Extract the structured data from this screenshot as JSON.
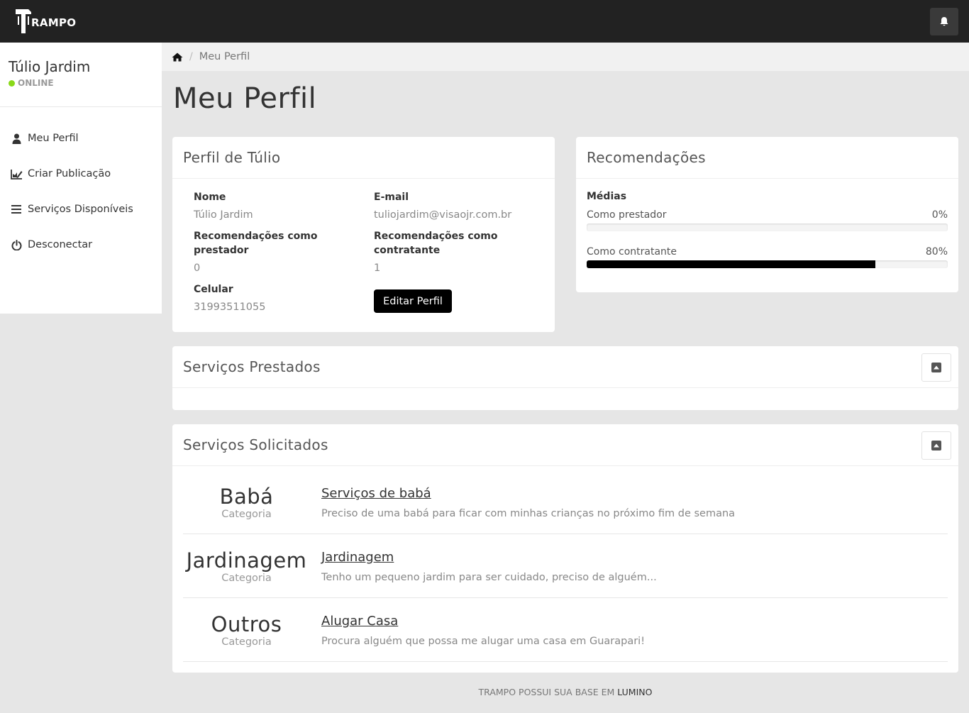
{
  "navbar": {
    "logo_text": "RAMPO",
    "notifications_icon": "bell-icon"
  },
  "sidebar": {
    "user_name": "Túlio Jardim",
    "status": "ONLINE",
    "status_color": "#8ad919",
    "items": [
      {
        "label": "Meu Perfil",
        "icon": "user-icon"
      },
      {
        "label": "Criar Publicação",
        "icon": "edit-chart-icon"
      },
      {
        "label": "Serviços Disponíveis",
        "icon": "list-icon"
      },
      {
        "label": "Desconectar",
        "icon": "power-icon"
      }
    ]
  },
  "breadcrumb": {
    "home_icon": "home-icon",
    "current": "Meu Perfil"
  },
  "page_title": "Meu Perfil",
  "profile": {
    "heading": "Perfil de Túlio",
    "name_label": "Nome",
    "name_value": "Túlio Jardim",
    "email_label": "E-mail",
    "email_value": "tuliojardim@visaojr.com.br",
    "rec_provider_label_1": "Recomendações como",
    "rec_provider_label_2": "prestador",
    "rec_provider_value": "0",
    "rec_client_label_1": "Recomendações como",
    "rec_client_label_2": "contratante",
    "rec_client_value": "1",
    "phone_label": "Celular",
    "phone_value": "31993511055",
    "edit_button": "Editar Perfil"
  },
  "recommendations": {
    "heading": "Recomendações",
    "subtitle": "Médias",
    "bars": [
      {
        "label": "Como prestador",
        "value_text": "0%",
        "value": 0
      },
      {
        "label": "Como contratante",
        "value_text": "80%",
        "value": 80
      }
    ]
  },
  "services_provided": {
    "heading": "Serviços Prestados"
  },
  "services_requested": {
    "heading": "Serviços Solicitados",
    "items": [
      {
        "category": "Babá",
        "category_label": "Categoria",
        "title": "Serviços de babá",
        "description": "Preciso de uma babá para ficar com minhas crianças no próximo fim de semana"
      },
      {
        "category": "Jardinagem",
        "category_label": "Categoria",
        "title": "Jardinagem",
        "description": "Tenho um pequeno jardim para ser cuidado, preciso de alguém..."
      },
      {
        "category": "Outros",
        "category_label": "Categoria",
        "title": "Alugar Casa",
        "description": "Procura alguém que possa me alugar uma casa em Guarapari!"
      }
    ]
  },
  "footer": {
    "text": "TRAMPO POSSUI SUA BASE EM ",
    "brand": "LUMINO"
  }
}
